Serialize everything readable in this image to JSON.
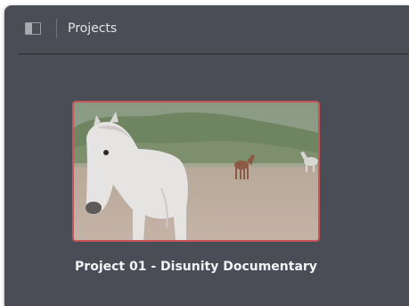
{
  "header": {
    "title": "Projects",
    "sidebar_toggle_icon": "sidebar-toggle-icon"
  },
  "projects": [
    {
      "name": "Project 01 - Disunity Documentary",
      "thumbnail": "horse-field-thumbnail",
      "selected": true
    }
  ],
  "colors": {
    "background": "#4a4d56",
    "selection_border": "#c9545a",
    "title_text": "#e3e4e7"
  }
}
